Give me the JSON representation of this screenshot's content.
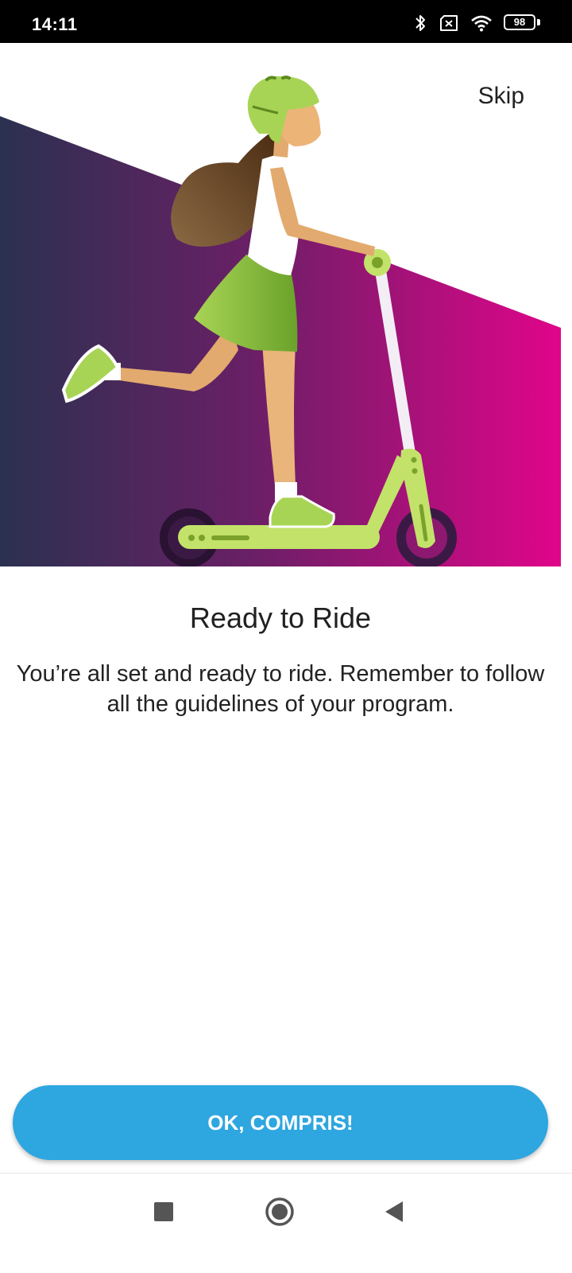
{
  "status_bar": {
    "time": "14:11",
    "battery_level": "98",
    "icons": [
      "bluetooth-icon",
      "sim-off-icon",
      "wifi-icon",
      "battery-icon"
    ]
  },
  "onboarding": {
    "skip_label": "Skip",
    "title": "Ready to Ride",
    "description": "You’re all set and ready to ride.  Remember to follow all the guidelines of your program.",
    "primary_button_label": "OK, COMPRIS!"
  },
  "navigation_bar": {
    "icons": [
      "recents-square-icon",
      "home-circle-icon",
      "back-triangle-icon"
    ]
  },
  "colors": {
    "accent_button": "#2ea6e0",
    "hero_gradient_start": "#2b3150",
    "hero_gradient_end": "#e0058a",
    "scooter_green": "#c2e26a"
  }
}
